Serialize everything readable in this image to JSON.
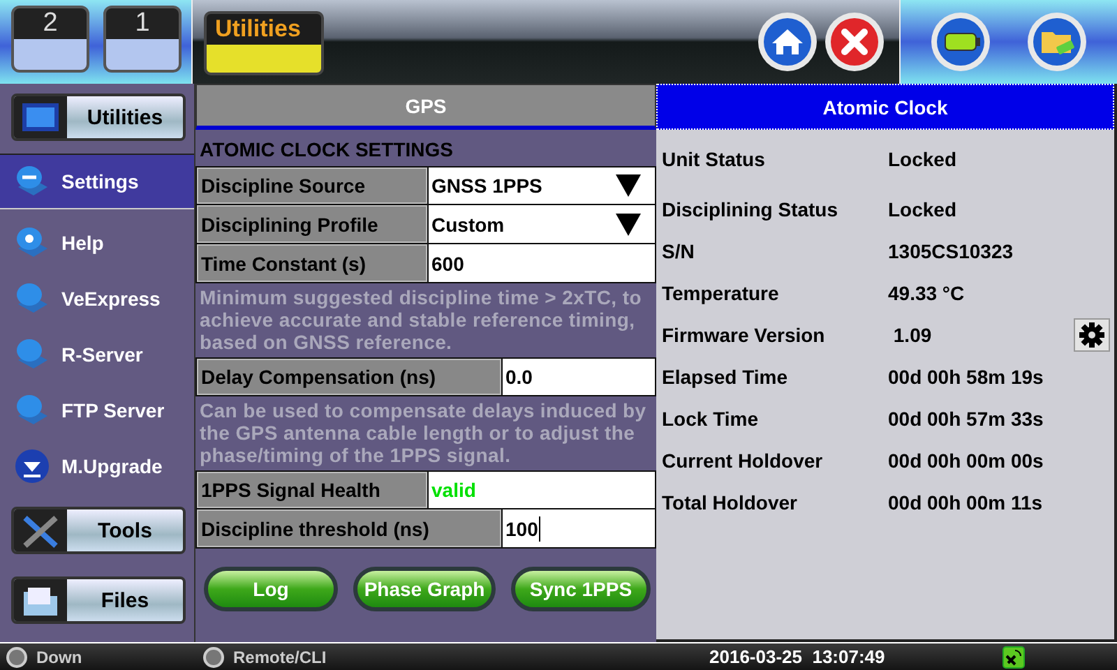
{
  "top_bar": {
    "workspaces": [
      {
        "label": "2"
      },
      {
        "label": "1"
      }
    ],
    "app_tab": {
      "label": "Utilities"
    }
  },
  "sidebar": {
    "header": {
      "label": "Utilities"
    },
    "items": [
      {
        "label": "Settings",
        "selected": true,
        "kind": "wrench"
      },
      {
        "label": "Help",
        "selected": false,
        "kind": "help"
      },
      {
        "label": "VeExpress",
        "selected": false,
        "kind": "bubble"
      },
      {
        "label": "R-Server",
        "selected": false,
        "kind": "bubble"
      },
      {
        "label": "FTP Server",
        "selected": false,
        "kind": "bubble"
      },
      {
        "label": "M.Upgrade",
        "selected": false,
        "kind": "download"
      }
    ],
    "bottom": [
      {
        "label": "Tools",
        "kind": "tools"
      },
      {
        "label": "Files",
        "kind": "files"
      }
    ]
  },
  "tabs": [
    {
      "label": "GPS",
      "selected": false
    },
    {
      "label": "Atomic Clock",
      "selected": true
    }
  ],
  "settings": {
    "title": "ATOMIC CLOCK SETTINGS",
    "rows": [
      {
        "kind": "dropdown",
        "label": "Discipline Source",
        "value": "GNSS 1PPS"
      },
      {
        "kind": "dropdown",
        "label": "Disciplining Profile",
        "value": "Custom"
      },
      {
        "kind": "input",
        "label": "Time Constant (s)",
        "value": "600",
        "focused": false
      },
      {
        "kind": "note",
        "text": "Minimum suggested discipline time > 2xTC, to achieve accurate and stable reference timing, based on GNSS reference."
      },
      {
        "kind": "input",
        "label": "Delay Compensation (ns)",
        "value": "0.0",
        "focused": false,
        "wide": true
      },
      {
        "kind": "note",
        "text": "Can be used to compensate delays induced by the GPS antenna cable length or to adjust the phase/timing of the 1PPS signal."
      },
      {
        "kind": "status",
        "label": "1PPS Signal Health",
        "value": "valid",
        "color": "#00e000"
      },
      {
        "kind": "input",
        "label": "Discipline threshold (ns)",
        "value": "100",
        "focused": true,
        "wide": true
      }
    ],
    "buttons": [
      {
        "label": "Log"
      },
      {
        "label": "Phase Graph"
      },
      {
        "label": "Sync 1PPS"
      }
    ]
  },
  "atomic_clock": {
    "rows": [
      {
        "label": "Unit Status",
        "value": "Locked"
      },
      {
        "label": "Disciplining Status",
        "value": "Locked"
      },
      {
        "label": "S/N",
        "value": "1305CS10323"
      },
      {
        "label": "Temperature",
        "value": "49.33 °C"
      },
      {
        "label": "Firmware Version",
        "value": " 1.09",
        "settings_button": true
      },
      {
        "label": "Elapsed Time",
        "value": "00d 00h 58m 19s"
      },
      {
        "label": "Lock Time",
        "value": "00d 00h 57m 33s"
      },
      {
        "label": "Current Holdover",
        "value": "00d 00h 00m 00s"
      },
      {
        "label": "Total Holdover",
        "value": "00d 00h 00m 11s"
      }
    ]
  },
  "status_bar": {
    "ip_status": "Down",
    "remote": "Remote/CLI",
    "datetime": "2016-03-25  13:07:49"
  }
}
